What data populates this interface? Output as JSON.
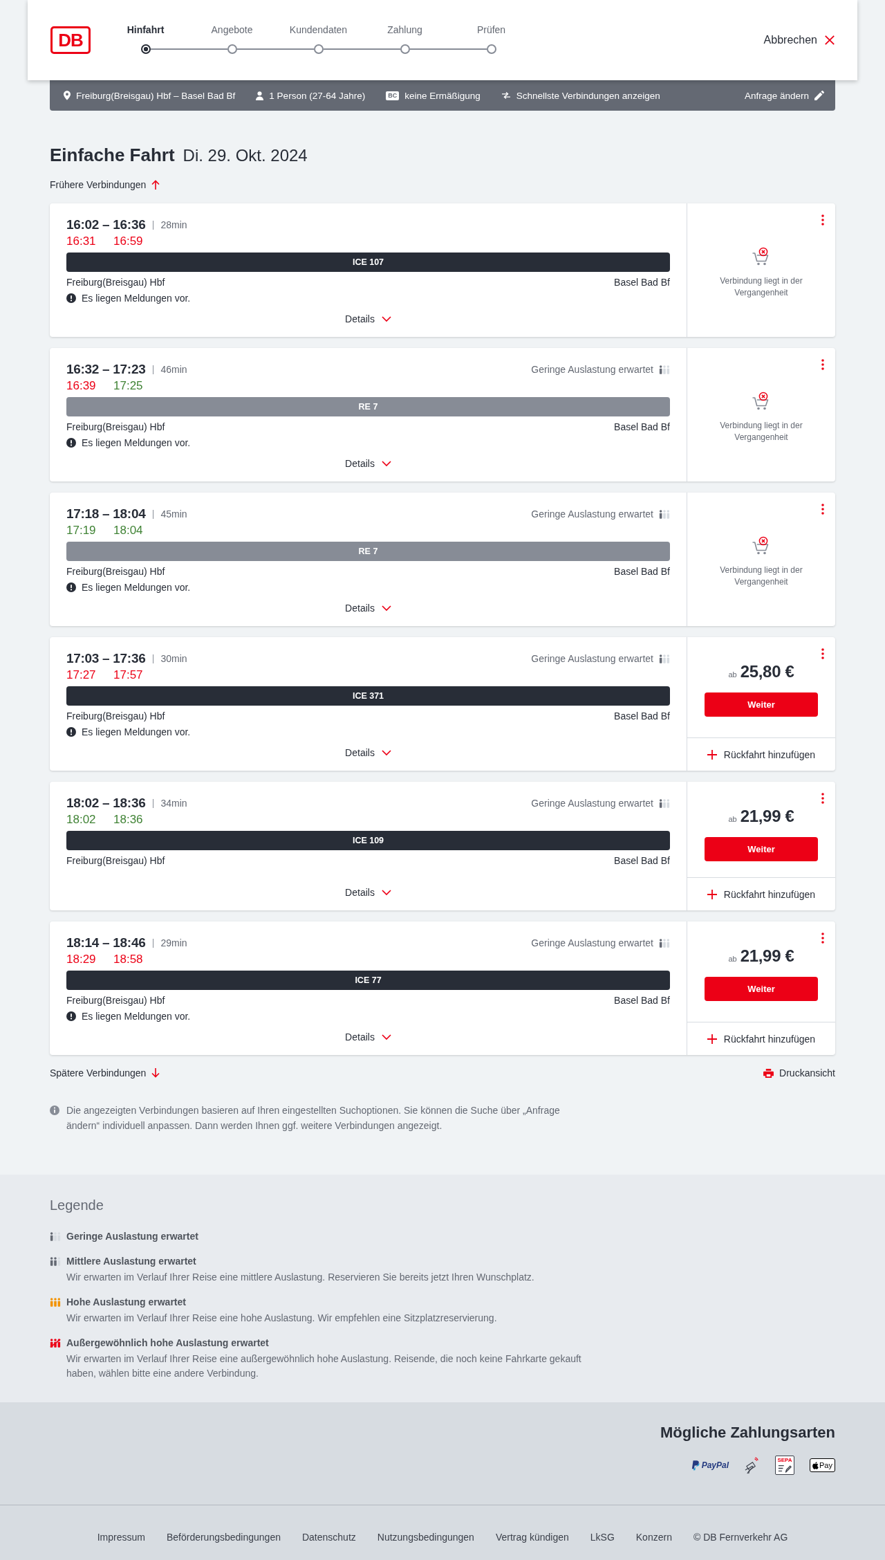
{
  "header": {
    "logo": "DB",
    "steps": [
      {
        "label": "Hinfahrt",
        "selected": true
      },
      {
        "label": "Angebote",
        "selected": false
      },
      {
        "label": "Kundendaten",
        "selected": false
      },
      {
        "label": "Zahlung",
        "selected": false
      },
      {
        "label": "Prüfen",
        "selected": false
      }
    ],
    "cancel": "Abbrechen"
  },
  "summary_bar": {
    "items": [
      {
        "kind": "route",
        "text": "Freiburg(Breisgau) Hbf – Basel Bad Bf"
      },
      {
        "kind": "travelers",
        "text": "1 Person (27-64 Jahre)"
      },
      {
        "kind": "discount",
        "badge": "BC",
        "text": "keine Ermäßigung"
      },
      {
        "kind": "sort",
        "text": "Schnellste Verbindungen anzeigen"
      }
    ],
    "edit": "Anfrage ändern"
  },
  "title": "Einfache Fahrt",
  "date": "Di. 29. Okt. 2024",
  "earlier": "Frühere Verbindungen",
  "connections": [
    {
      "times": "16:02 – 16:36",
      "duration": "28min",
      "realtime": [
        {
          "time": "16:31",
          "delayed": true
        },
        {
          "time": "16:59",
          "delayed": true
        }
      ],
      "train": {
        "label": "ICE 107",
        "kind": "longdistance"
      },
      "from": "Freiburg(Breisgau) Hbf",
      "to": "Basel Bad Bf",
      "notice": "Es liegen Meldungen vor.",
      "details": "Details",
      "offer": {
        "kind": "past",
        "text": "Verbindung liegt in der Vergangenheit"
      }
    },
    {
      "times": "16:32 – 17:23",
      "duration": "46min",
      "occupancy": {
        "kind": "low",
        "text": "Geringe Auslastung erwartet"
      },
      "realtime": [
        {
          "time": "16:39",
          "delayed": true
        },
        {
          "time": "17:25",
          "delayed": false
        }
      ],
      "train": {
        "label": "RE 7",
        "kind": "regional"
      },
      "from": "Freiburg(Breisgau) Hbf",
      "to": "Basel Bad Bf",
      "notice": "Es liegen Meldungen vor.",
      "details": "Details",
      "offer": {
        "kind": "past",
        "text": "Verbindung liegt in der Vergangenheit"
      }
    },
    {
      "times": "17:18 – 18:04",
      "duration": "45min",
      "occupancy": {
        "kind": "low",
        "text": "Geringe Auslastung erwartet"
      },
      "realtime": [
        {
          "time": "17:19",
          "delayed": false
        },
        {
          "time": "18:04",
          "delayed": false
        }
      ],
      "train": {
        "label": "RE 7",
        "kind": "regional"
      },
      "from": "Freiburg(Breisgau) Hbf",
      "to": "Basel Bad Bf",
      "notice": "Es liegen Meldungen vor.",
      "details": "Details",
      "offer": {
        "kind": "past",
        "text": "Verbindung liegt in der Vergangenheit"
      }
    },
    {
      "times": "17:03 – 17:36",
      "duration": "30min",
      "occupancy": {
        "kind": "low",
        "text": "Geringe Auslastung erwartet"
      },
      "realtime": [
        {
          "time": "17:27",
          "delayed": true
        },
        {
          "time": "17:57",
          "delayed": true
        }
      ],
      "train": {
        "label": "ICE 371",
        "kind": "longdistance"
      },
      "from": "Freiburg(Breisgau) Hbf",
      "to": "Basel Bad Bf",
      "notice": "Es liegen Meldungen vor.",
      "details": "Details",
      "offer": {
        "kind": "bookable",
        "prefix": "ab",
        "price": "25,80 €",
        "button": "Weiter",
        "return": "Rückfahrt hinzufügen"
      }
    },
    {
      "times": "18:02 – 18:36",
      "duration": "34min",
      "occupancy": {
        "kind": "low",
        "text": "Geringe Auslastung erwartet"
      },
      "realtime": [
        {
          "time": "18:02",
          "delayed": false
        },
        {
          "time": "18:36",
          "delayed": false
        }
      ],
      "train": {
        "label": "ICE 109",
        "kind": "longdistance"
      },
      "from": "Freiburg(Breisgau) Hbf",
      "to": "Basel Bad Bf",
      "details": "Details",
      "offer": {
        "kind": "bookable",
        "prefix": "ab",
        "price": "21,99 €",
        "button": "Weiter",
        "return": "Rückfahrt hinzufügen"
      }
    },
    {
      "times": "18:14 – 18:46",
      "duration": "29min",
      "occupancy": {
        "kind": "low",
        "text": "Geringe Auslastung erwartet"
      },
      "realtime": [
        {
          "time": "18:29",
          "delayed": true
        },
        {
          "time": "18:58",
          "delayed": true
        }
      ],
      "train": {
        "label": "ICE 77",
        "kind": "longdistance"
      },
      "from": "Freiburg(Breisgau) Hbf",
      "to": "Basel Bad Bf",
      "notice": "Es liegen Meldungen vor.",
      "details": "Details",
      "offer": {
        "kind": "bookable",
        "prefix": "ab",
        "price": "21,99 €",
        "button": "Weiter",
        "return": "Rückfahrt hinzufügen"
      }
    }
  ],
  "later": "Spätere Verbindungen",
  "print": "Druckansicht",
  "info": "Die angezeigten Verbindungen basieren auf Ihren eingestellten Suchoptionen. Sie können die Suche über „Anfrage ändern“ individuell anpassen. Dann werden Ihnen ggf. weitere Verbindungen angezeigt.",
  "legend": {
    "title": "Legende",
    "items": [
      {
        "kind": "low",
        "title": "Geringe Auslastung erwartet"
      },
      {
        "kind": "medium",
        "title": "Mittlere Auslastung erwartet",
        "description": "Wir erwarten im Verlauf Ihrer Reise eine mittlere Auslastung. Reservieren Sie bereits jetzt Ihren Wunschplatz."
      },
      {
        "kind": "high",
        "title": "Hohe Auslastung erwartet",
        "description": "Wir erwarten im Verlauf Ihrer Reise eine hohe Auslastung. Wir empfehlen eine Sitzplatzreservierung."
      },
      {
        "kind": "extreme",
        "title": "Außergewöhnlich hohe Auslastung erwartet",
        "description": "Wir erwarten im Verlauf Ihrer Reise eine außergewöhnlich hohe Auslastung. Reisende, die noch keine Fahrkarte gekauft haben, wählen bitte eine andere Verbindung."
      }
    ]
  },
  "payment": {
    "title": "Mögliche Zahlungsarten",
    "methods": [
      {
        "kind": "paypal",
        "label": "PayPal"
      },
      {
        "kind": "contactless"
      },
      {
        "kind": "sepa",
        "label": "SEPA"
      },
      {
        "kind": "applepay",
        "label": "Pay"
      }
    ]
  },
  "footer": {
    "links": [
      "Impressum",
      "Beförderungsbedingungen",
      "Datenschutz",
      "Nutzungsbedingungen",
      "Vertrag kündigen",
      "LkSG",
      "Konzern"
    ],
    "copyright": "© DB Fernverkehr AG"
  }
}
